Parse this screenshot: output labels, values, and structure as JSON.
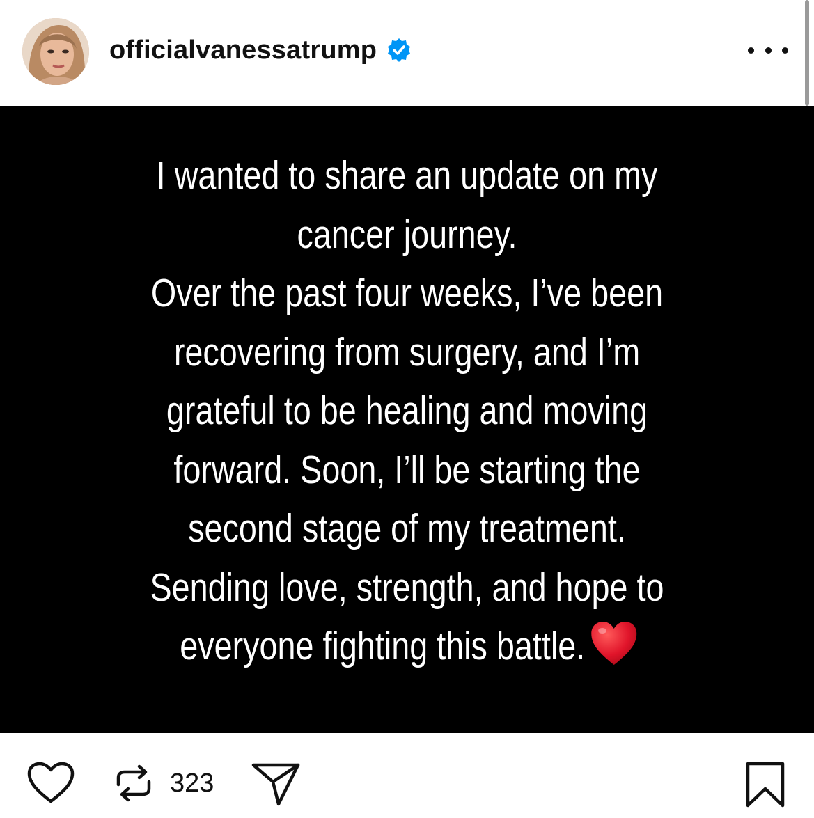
{
  "post": {
    "username": "officialvanessatrump",
    "verified_icon": "verified-badge-icon",
    "text_lines": [
      "I wanted to share an update on my",
      "cancer journey.",
      "Over the past four weeks, I’ve been",
      "recovering from surgery, and I’m",
      "grateful to be healing and moving",
      "forward. Soon, I’ll be starting the",
      "second stage of my treatment.",
      "Sending love, strength, and hope to",
      "everyone fighting this battle."
    ],
    "emoji": "red-heart-emoji",
    "background_color": "#000000",
    "text_color": "#ffffff"
  },
  "actions": {
    "repost_count": "323",
    "icons": [
      "heart-icon",
      "repost-icon",
      "share-icon",
      "bookmark-icon"
    ]
  },
  "colors": {
    "verified_blue": "#0095f6",
    "heart_red": "#e0142a"
  }
}
